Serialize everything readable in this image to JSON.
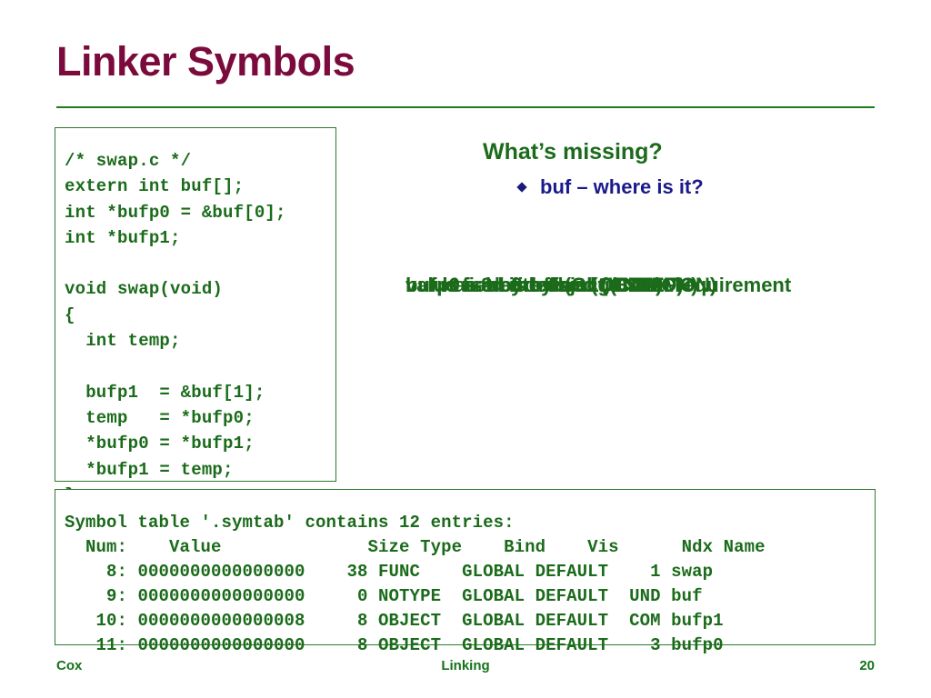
{
  "slide": {
    "title": "Linker Symbols",
    "page_number": "20",
    "footer_left": "Cox",
    "footer_center": "Linking",
    "accent_title_color": "#7a0b3c",
    "accent_rule_color": "#1f7a1f",
    "code_color": "#1b6b1b",
    "bullet_color": "#1a1a8c"
  },
  "code_panel": {
    "filename_comment": "/* swap.c */",
    "source": "/* swap.c */\nextern int buf[];\nint *bufp0 = &buf[0];\nint *bufp1;\n\nvoid swap(void)\n{\n  int temp;\n\n  bufp1  = &buf[1];\n  temp   = *bufp0;\n  *bufp0 = *bufp1;\n  *bufp1 = temp;\n}"
  },
  "right_panel": {
    "heading": "What’s missing?",
    "bullet": "buf – where is it?",
    "bullet_glyph": "diamond-bullet",
    "overlay_notes": [
      "buf is a 8-byte object (COMMON)",
      "bufp0 is defined (GLOBAL)",
      "bufp1 is not defined (UNDEF)",
      "buf has an 8-byte alignment requirement",
      "value field is offset (COMMON)"
    ]
  },
  "symbol_table": {
    "caption": "Symbol table '.symtab' contains 12 entries:",
    "columns": [
      "Num:",
      "Value",
      "Size",
      "Type",
      "Bind",
      "Vis",
      "Ndx",
      "Name"
    ],
    "header_line": "  Num:    Value              Size Type    Bind    Vis      Ndx Name",
    "rows": [
      {
        "num": "8:",
        "value": "0000000000000000",
        "size": "38",
        "type": "FUNC",
        "bind": "GLOBAL",
        "vis": "DEFAULT",
        "ndx": "1",
        "name": "swap",
        "line": "    8: 0000000000000000    38 FUNC    GLOBAL DEFAULT    1 swap"
      },
      {
        "num": "9:",
        "value": "0000000000000000",
        "size": "0",
        "type": "NOTYPE",
        "bind": "GLOBAL",
        "vis": "DEFAULT",
        "ndx": "UND",
        "name": "buf",
        "line": "    9: 0000000000000000     0 NOTYPE  GLOBAL DEFAULT  UND buf"
      },
      {
        "num": "10:",
        "value": "0000000000000008",
        "size": "8",
        "type": "OBJECT",
        "bind": "GLOBAL",
        "vis": "DEFAULT",
        "ndx": "COM",
        "name": "bufp1",
        "line": "   10: 0000000000000008     8 OBJECT  GLOBAL DEFAULT  COM bufp1"
      },
      {
        "num": "11:",
        "value": "0000000000000000",
        "size": "8",
        "type": "OBJECT",
        "bind": "GLOBAL",
        "vis": "DEFAULT",
        "ndx": "3",
        "name": "bufp0",
        "line": "   11: 0000000000000000     8 OBJECT  GLOBAL DEFAULT    3 bufp0"
      }
    ],
    "full_text": "Symbol table '.symtab' contains 12 entries:\n  Num:    Value              Size Type    Bind    Vis      Ndx Name\n    8: 0000000000000000    38 FUNC    GLOBAL DEFAULT    1 swap\n    9: 0000000000000000     0 NOTYPE  GLOBAL DEFAULT  UND buf\n   10: 0000000000000008     8 OBJECT  GLOBAL DEFAULT  COM bufp1\n   11: 0000000000000000     8 OBJECT  GLOBAL DEFAULT    3 bufp0"
  }
}
